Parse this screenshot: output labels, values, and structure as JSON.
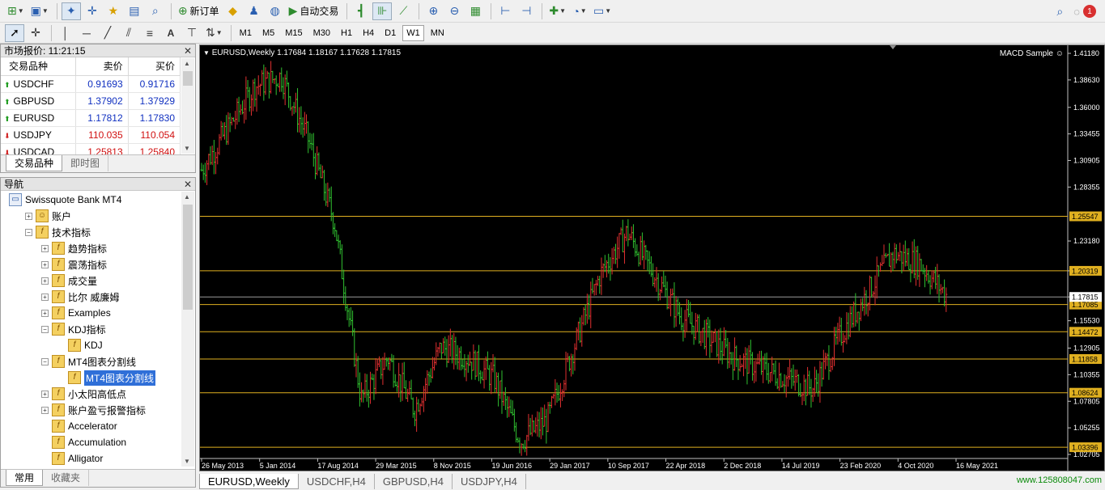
{
  "toolbar": {
    "new_order_label": "新订单",
    "auto_trading_label": "自动交易",
    "timeframes": [
      "M1",
      "M5",
      "M15",
      "M30",
      "H1",
      "H4",
      "D1",
      "W1",
      "MN"
    ],
    "active_timeframe": "W1",
    "notification_count": "1"
  },
  "market_watch": {
    "title": "市场报价: 11:21:15",
    "columns": [
      "交易品种",
      "卖价",
      "买价"
    ],
    "rows": [
      {
        "symbol": "USDCHF",
        "bid": "0.91693",
        "ask": "0.91716",
        "direction": "up",
        "color": "#1030c0"
      },
      {
        "symbol": "GBPUSD",
        "bid": "1.37902",
        "ask": "1.37929",
        "direction": "up",
        "color": "#1030c0"
      },
      {
        "symbol": "EURUSD",
        "bid": "1.17812",
        "ask": "1.17830",
        "direction": "up",
        "color": "#1030c0"
      },
      {
        "symbol": "USDJPY",
        "bid": "110.035",
        "ask": "110.054",
        "direction": "down",
        "color": "#d01010"
      },
      {
        "symbol": "USDCAD",
        "bid": "1.25813",
        "ask": "1.25840",
        "direction": "down",
        "color": "#d01010"
      }
    ],
    "tabs": [
      "交易品种",
      "即时图"
    ]
  },
  "navigator": {
    "title": "导航",
    "items": [
      {
        "label": "Swissquote Bank MT4",
        "level": 0,
        "expander": "",
        "icon": "root"
      },
      {
        "label": "账户",
        "level": 1,
        "expander": "+",
        "icon": "accounts"
      },
      {
        "label": "技术指标",
        "level": 1,
        "expander": "-",
        "icon": "indicator"
      },
      {
        "label": "趋势指标",
        "level": 2,
        "expander": "+",
        "icon": "indicator"
      },
      {
        "label": "震荡指标",
        "level": 2,
        "expander": "+",
        "icon": "indicator"
      },
      {
        "label": "成交量",
        "level": 2,
        "expander": "+",
        "icon": "indicator"
      },
      {
        "label": "比尔 威廉姆",
        "level": 2,
        "expander": "+",
        "icon": "indicator"
      },
      {
        "label": "Examples",
        "level": 2,
        "expander": "+",
        "icon": "indicator"
      },
      {
        "label": "KDJ指标",
        "level": 2,
        "expander": "-",
        "icon": "indicator"
      },
      {
        "label": "KDJ",
        "level": 3,
        "expander": "",
        "icon": "indicator"
      },
      {
        "label": "MT4图表分割线",
        "level": 2,
        "expander": "-",
        "icon": "indicator"
      },
      {
        "label": "MT4图表分割线",
        "level": 3,
        "expander": "",
        "icon": "indicator",
        "selected": true
      },
      {
        "label": "小太阳高低点",
        "level": 2,
        "expander": "+",
        "icon": "indicator"
      },
      {
        "label": "账户盈亏报警指标",
        "level": 2,
        "expander": "+",
        "icon": "indicator"
      },
      {
        "label": "Accelerator",
        "level": 2,
        "expander": "",
        "icon": "indicator"
      },
      {
        "label": "Accumulation",
        "level": 2,
        "expander": "",
        "icon": "indicator"
      },
      {
        "label": "Alligator",
        "level": 2,
        "expander": "",
        "icon": "indicator"
      }
    ],
    "tabs": [
      "常用",
      "收藏夹"
    ]
  },
  "chart": {
    "header": "EURUSD,Weekly  1.17684 1.18167 1.17628 1.17815",
    "ea_label": "MACD Sample",
    "colors": {
      "background": "#000000",
      "up": "#e03030",
      "down": "#30c030",
      "hline": "#e0b020",
      "price_box": "#e0b020"
    }
  },
  "chart_data": {
    "type": "line",
    "title": "EURUSD,Weekly",
    "symbol": "EURUSD",
    "timeframe": "Weekly",
    "ohlc_last": {
      "open": 1.17684,
      "high": 1.18167,
      "low": 1.17628,
      "close": 1.17815
    },
    "y_ticks": [
      1.4118,
      1.3863,
      1.36,
      1.33455,
      1.30905,
      1.28355,
      1.2318,
      1.20319,
      1.17815,
      1.1553,
      1.12905,
      1.10355,
      1.07805,
      1.05255,
      1.02705
    ],
    "ylim": [
      1.02705,
      1.4118
    ],
    "x_ticks": [
      "26 May 2013",
      "5 Jan 2014",
      "17 Aug 2014",
      "29 Mar 2015",
      "8 Nov 2015",
      "19 Jun 2016",
      "29 Jan 2017",
      "10 Sep 2017",
      "22 Apr 2018",
      "2 Dec 2018",
      "14 Jul 2019",
      "23 Feb 2020",
      "4 Oct 2020",
      "16 May 2021"
    ],
    "horizontal_lines": [
      1.25547,
      1.20319,
      1.17085,
      1.14472,
      1.11858,
      1.08624,
      1.03396
    ],
    "current_price": 1.17815,
    "series": [
      {
        "x": [
          "26 May 2013",
          "Oct 2013",
          "5 Jan 2014",
          "May 2014",
          "17 Aug 2014",
          "Dec 2014",
          "29 Mar 2015",
          "Jul 2015",
          "8 Nov 2015",
          "Mar 2016",
          "19 Jun 2016",
          "Oct 2016",
          "Dec 2016",
          "29 Jan 2017",
          "May 2017",
          "10 Sep 2017",
          "Jan 2018",
          "22 Apr 2018",
          "Aug 2018",
          "2 Dec 2018",
          "Apr 2019",
          "14 Jul 2019",
          "Oct 2019",
          "23 Feb 2020",
          "May 2020",
          "4 Oct 2020",
          "Jan 2021",
          "16 May 2021",
          "Jul 2021"
        ],
        "values": [
          1.3,
          1.34,
          1.38,
          1.39,
          1.33,
          1.25,
          1.08,
          1.12,
          1.07,
          1.13,
          1.12,
          1.1,
          1.04,
          1.06,
          1.13,
          1.2,
          1.24,
          1.2,
          1.16,
          1.14,
          1.12,
          1.11,
          1.1,
          1.09,
          1.14,
          1.18,
          1.22,
          1.21,
          1.18
        ]
      }
    ]
  },
  "chart_tabs": [
    "EURUSD,Weekly",
    "USDCHF,H4",
    "GBPUSD,H4",
    "USDJPY,H4"
  ],
  "status_url": "www.125808047.com"
}
